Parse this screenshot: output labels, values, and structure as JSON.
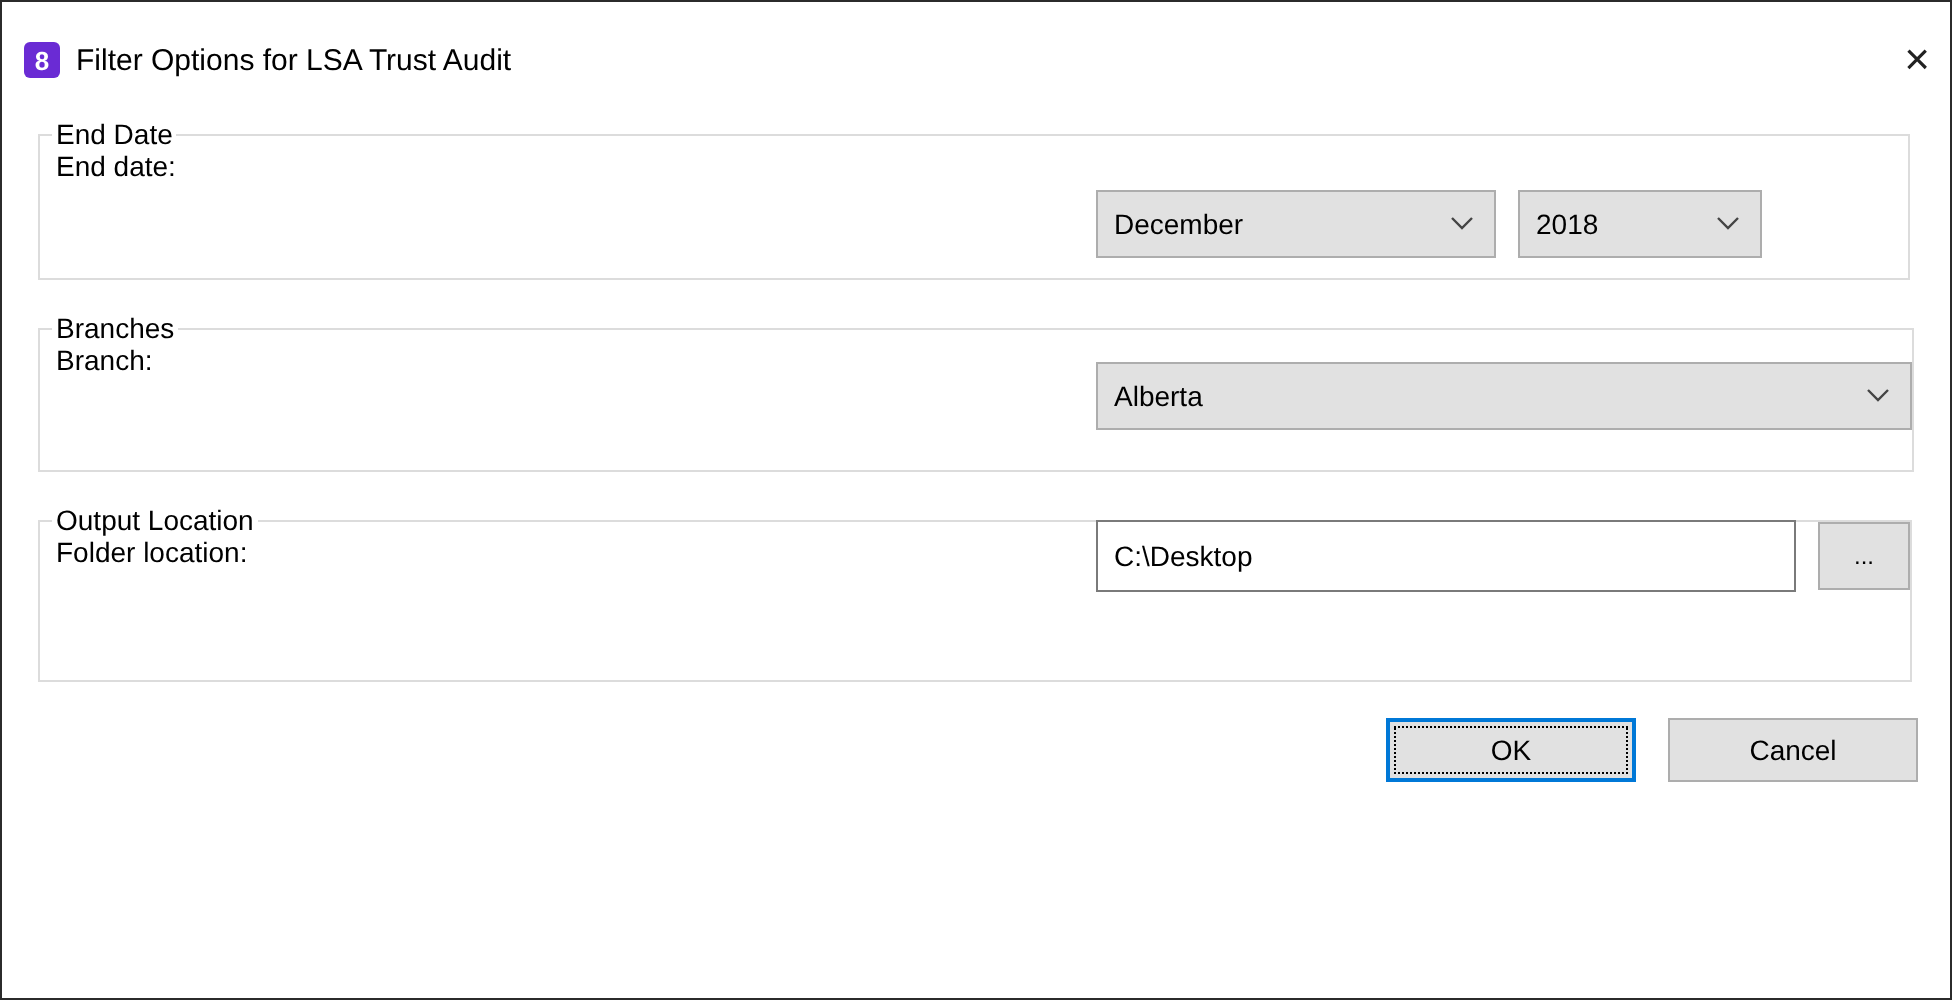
{
  "window": {
    "title": "Filter Options for LSA Trust Audit",
    "app_icon_glyph": "8",
    "close": "×"
  },
  "groups": [
    {
      "kind": "dates",
      "title": "End Date",
      "label": "End date:",
      "selects": [
        {
          "value": "December"
        },
        {
          "value": "2018"
        }
      ]
    },
    {
      "kind": "select",
      "title": "Branches",
      "label": "Branch:",
      "selects": [
        {
          "value": "Alberta"
        }
      ]
    },
    {
      "kind": "folder",
      "title": "Output Location",
      "label": "Folder location:",
      "value": "C:\\Desktop",
      "browse": "..."
    }
  ],
  "buttons": [
    {
      "label": "OK",
      "focused": true
    },
    {
      "label": "Cancel",
      "focused": false
    }
  ]
}
